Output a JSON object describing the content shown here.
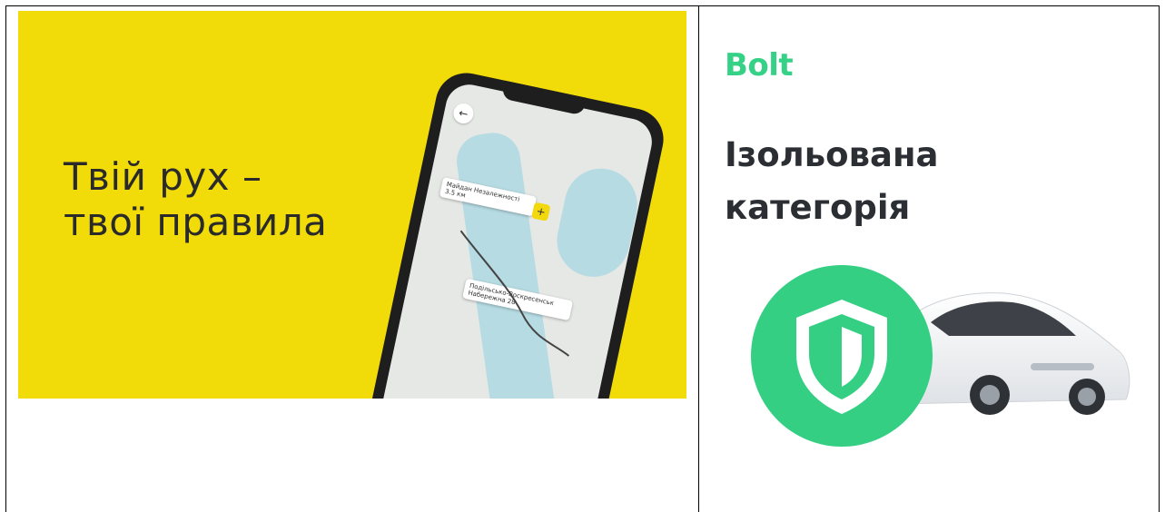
{
  "left_banner": {
    "headline_line1": "Твій рух –",
    "headline_line2": "твої правила",
    "background_color": "#f1dc0a",
    "phone_map": {
      "card1_line1": "Майдан Незалежності",
      "card1_line2": "3.5 км",
      "card2_line1": "Подільсько-Воскресенськ",
      "card2_line2": "Набережна 28"
    }
  },
  "right_banner": {
    "brand": "Bolt",
    "title_line1": "Ізольована",
    "title_line2": "категорія",
    "brand_color": "#34d186",
    "shield_color": "#34cf83"
  }
}
